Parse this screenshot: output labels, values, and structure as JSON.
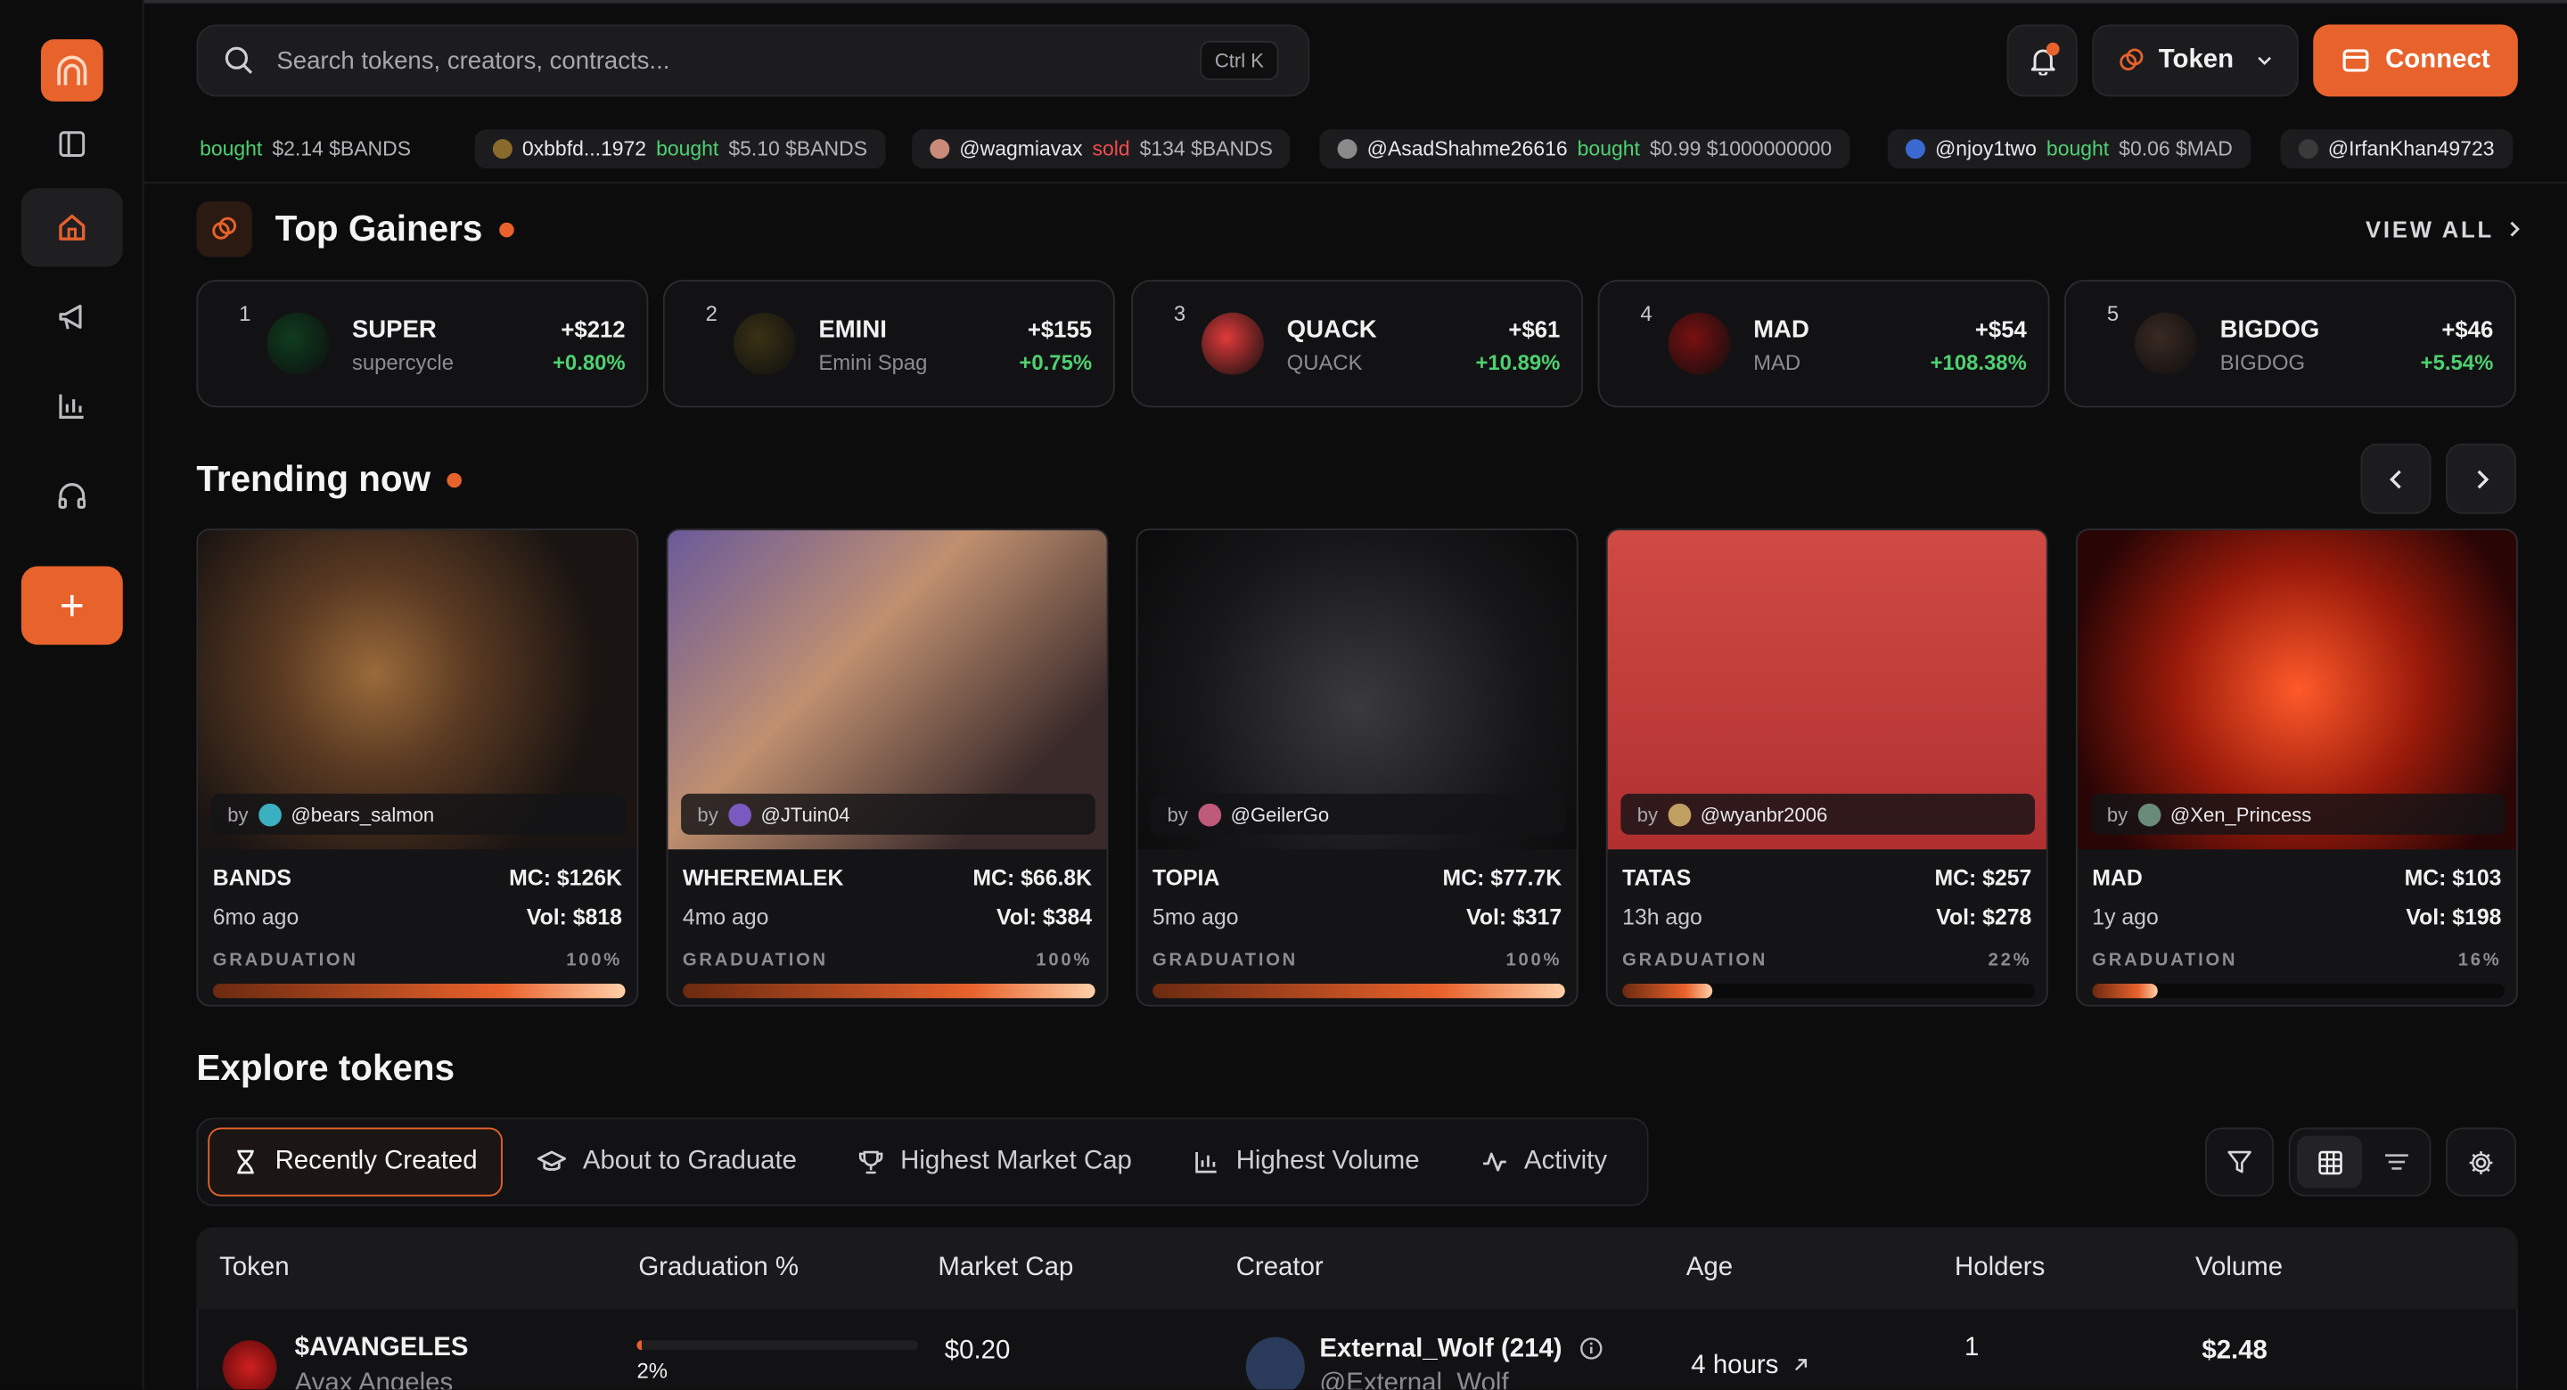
{
  "header": {
    "search_placeholder": "Search tokens, creators, contracts...",
    "shortcut": "Ctrl K",
    "token_label": "Token",
    "connect_label": "Connect"
  },
  "ticker": [
    {
      "user": "",
      "action": "bought",
      "amount": "$2.14 $BANDS",
      "type": "buy"
    },
    {
      "user": "0xbbfd...1972",
      "action": "bought",
      "amount": "$5.10 $BANDS",
      "type": "buy"
    },
    {
      "user": "@wagmiavax",
      "action": "sold",
      "amount": "$134 $BANDS",
      "type": "sell"
    },
    {
      "user": "@AsadShahme26616",
      "action": "bought",
      "amount": "$0.99 $1000000000",
      "type": "buy"
    },
    {
      "user": "@njoy1two",
      "action": "bought",
      "amount": "$0.06 $MAD",
      "type": "buy"
    },
    {
      "user": "@IrfanKhan49723",
      "action": "",
      "amount": "",
      "type": "buy"
    }
  ],
  "top_gainers": {
    "title": "Top Gainers",
    "view_all": "VIEW ALL",
    "items": [
      {
        "rank": "1",
        "name": "SUPER",
        "sub": "supercycle",
        "value": "+$212",
        "pct": "+0.80%",
        "color": "#0f3d1e"
      },
      {
        "rank": "2",
        "name": "EMINI",
        "sub": "Emini Spag",
        "value": "+$155",
        "pct": "+0.75%",
        "color": "#3a3215"
      },
      {
        "rank": "3",
        "name": "QUACK",
        "sub": "QUACK",
        "value": "+$61",
        "pct": "+10.89%",
        "color": "#e03a3a"
      },
      {
        "rank": "4",
        "name": "MAD",
        "sub": "MAD",
        "value": "+$54",
        "pct": "+108.38%",
        "color": "#7a1010"
      },
      {
        "rank": "5",
        "name": "BIGDOG",
        "sub": "BIGDOG",
        "value": "+$46",
        "pct": "+5.54%",
        "color": "#3a2a22"
      }
    ]
  },
  "trending": {
    "title": "Trending now",
    "cards": [
      {
        "creator": "@bears_salmon",
        "name": "BANDS",
        "mc": "MC: $126K",
        "age": "6mo ago",
        "vol": "Vol: $818",
        "grad_label": "GRADUATION",
        "grad_pct": "100%",
        "grad": 1.0
      },
      {
        "creator": "@JTuin04",
        "name": "WHEREMALEK",
        "mc": "MC: $66.8K",
        "age": "4mo ago",
        "vol": "Vol: $384",
        "grad_label": "GRADUATION",
        "grad_pct": "100%",
        "grad": 1.0
      },
      {
        "creator": "@GeilerGo",
        "name": "TOPIA",
        "mc": "MC: $77.7K",
        "age": "5mo ago",
        "vol": "Vol: $317",
        "grad_label": "GRADUATION",
        "grad_pct": "100%",
        "grad": 1.0
      },
      {
        "creator": "@wyanbr2006",
        "name": "TATAS",
        "mc": "MC: $257",
        "age": "13h ago",
        "vol": "Vol: $278",
        "grad_label": "GRADUATION",
        "grad_pct": "22%",
        "grad": 0.22
      },
      {
        "creator": "@Xen_Princess",
        "name": "MAD",
        "mc": "MC: $103",
        "age": "1y ago",
        "vol": "Vol: $198",
        "grad_label": "GRADUATION",
        "grad_pct": "16%",
        "grad": 0.16
      }
    ]
  },
  "explore": {
    "title": "Explore tokens",
    "tabs": [
      "Recently Created",
      "About to Graduate",
      "Highest Market Cap",
      "Highest Volume",
      "Activity"
    ]
  },
  "table": {
    "columns": [
      "Token",
      "Graduation %",
      "Market Cap",
      "Creator",
      "Age",
      "Holders",
      "Volume"
    ],
    "rows": [
      {
        "token": "$AVANGELES",
        "token_sub": "Avax Angeles",
        "grad_pct": "2%",
        "grad": 0.02,
        "mc": "$0.20",
        "creator": "External_Wolf (214)",
        "creator_sub": "@External_Wolf",
        "age": "4 hours",
        "holders": "1",
        "volume": "$2.48"
      }
    ]
  },
  "colors": {
    "accent": "#e8622c",
    "buy": "#4fd071",
    "sell": "#ef4d4d"
  }
}
